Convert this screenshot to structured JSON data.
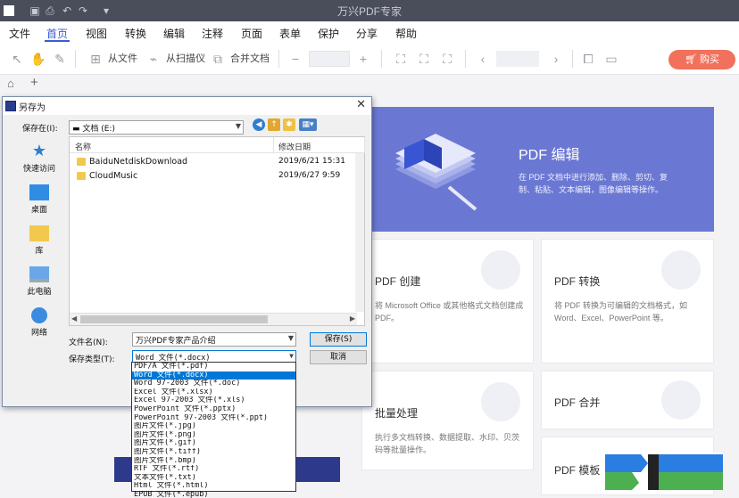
{
  "app": {
    "title": "万兴PDF专家"
  },
  "menu": [
    "文件",
    "首页",
    "视图",
    "转换",
    "编辑",
    "注释",
    "页面",
    "表单",
    "保护",
    "分享",
    "帮助"
  ],
  "menu_active": "首页",
  "toolbar": {
    "from_file": "从文件",
    "from_scanner": "从扫描仪",
    "merge": "合并文档",
    "buy": "购买"
  },
  "cards": {
    "hero": {
      "title": "PDF 编辑",
      "desc": "在 PDF 文档中进行添加、删除、剪切、复制、粘贴、文本编辑，图像编辑等操作。"
    },
    "create": {
      "title": "PDF 创建",
      "desc": "将 Microsoft Office 或其他格式文档创建成 PDF。"
    },
    "convert": {
      "title": "PDF 转换",
      "desc": "将 PDF 转换为可编辑的文档格式，如 Word、Excel、PowerPoint 等。"
    },
    "batch": {
      "title": "批量处理",
      "desc": "执行多文档转换、数据提取、水印、贝茨码等批量操作。"
    },
    "merge": {
      "title": "PDF 合并"
    },
    "template": {
      "title": "PDF 模板"
    }
  },
  "dialog": {
    "title": "另存为",
    "save_in_label": "保存在(I):",
    "save_in_value": "文档 (E:)",
    "places": [
      "快速访问",
      "桌面",
      "库",
      "此电脑",
      "网络"
    ],
    "columns": {
      "name": "名称",
      "modified": "修改日期"
    },
    "files": [
      {
        "name": "BaiduNetdiskDownload",
        "date": "2019/6/21 15:31"
      },
      {
        "name": "CloudMusic",
        "date": "2019/6/27 9:59"
      }
    ],
    "filename_label": "文件名(N):",
    "filename_value": "万兴PDF专家产品介绍",
    "type_label": "保存类型(T):",
    "type_value": "Word 文件(*.docx)",
    "save_button": "保存(S)",
    "cancel_button": "取消",
    "type_options": [
      "PDF/A 文件(*.pdf)",
      "Word 文件(*.docx)",
      "Word 97-2003 文件(*.doc)",
      "Excel 文件(*.xlsx)",
      "Excel 97-2003 文件(*.xls)",
      "PowerPoint 文件(*.pptx)",
      "PowerPoint 97-2003 文件(*.ppt)",
      "图片文件(*.jpg)",
      "图片文件(*.png)",
      "图片文件(*.gif)",
      "图片文件(*.tiff)",
      "图片文件(*.bmp)",
      "RTF 文件(*.rtf)",
      "文本文件(*.txt)",
      "Html 文件(*.html)",
      "EPUB 文件(*.epub)"
    ],
    "type_selected_index": 1
  },
  "colors": {
    "accent": "#3b5bd6",
    "hero": "#6b78d3",
    "buy": "#f2715c",
    "titlebar": "#4a4d5a",
    "selection": "#0078d7"
  }
}
